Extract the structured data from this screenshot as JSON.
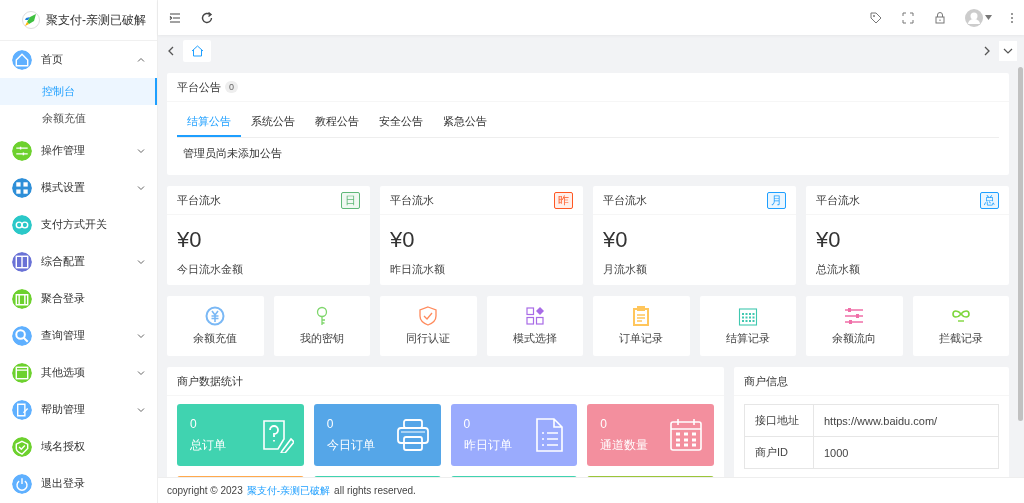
{
  "brand": {
    "name": "聚支付-亲测已破解"
  },
  "sidebar": {
    "items": [
      {
        "label": "首页",
        "color": "#5fb0ff",
        "expanded": true,
        "children": [
          {
            "label": "控制台",
            "selected": true
          },
          {
            "label": "余额充值",
            "selected": false
          }
        ]
      },
      {
        "label": "操作管理",
        "color": "#6dd12e",
        "expanded": false
      },
      {
        "label": "模式设置",
        "color": "#2e8fd8",
        "expanded": false
      },
      {
        "label": "支付方式开关",
        "color": "#2bc8c8"
      },
      {
        "label": "综合配置",
        "color": "#6a72d6",
        "expanded": false
      },
      {
        "label": "聚合登录",
        "color": "#6dd12e"
      },
      {
        "label": "查询管理",
        "color": "#5fb0ff",
        "expanded": false
      },
      {
        "label": "其他选项",
        "color": "#6dd12e",
        "expanded": false
      },
      {
        "label": "帮助管理",
        "color": "#5fb0ff",
        "expanded": false
      },
      {
        "label": "域名授权",
        "color": "#6dd12e"
      },
      {
        "label": "退出登录",
        "color": "#5fb0ff"
      }
    ]
  },
  "notice": {
    "title": "平台公告",
    "count": "0",
    "tabs": [
      {
        "label": "结算公告",
        "selected": true
      },
      {
        "label": "系统公告",
        "selected": false
      },
      {
        "label": "教程公告",
        "selected": false
      },
      {
        "label": "安全公告",
        "selected": false
      },
      {
        "label": "紧急公告",
        "selected": false
      }
    ],
    "message": "管理员尚未添加公告"
  },
  "flow_cards": [
    {
      "title": "平台流水",
      "badge": "日",
      "color": "#5fb878",
      "amount": "¥0",
      "label": "今日流水金额"
    },
    {
      "title": "平台流水",
      "badge": "昨",
      "color": "#ff5722",
      "amount": "¥0",
      "label": "昨日流水额"
    },
    {
      "title": "平台流水",
      "badge": "月",
      "color": "#1e9fff",
      "amount": "¥0",
      "label": "月流水额"
    },
    {
      "title": "平台流水",
      "badge": "总",
      "color": "#1e9fff",
      "amount": "¥0",
      "label": "总流水额"
    }
  ],
  "shortcuts": [
    {
      "label": "余额充值",
      "color": "#7ab8f5"
    },
    {
      "label": "我的密钥",
      "color": "#7ed66b"
    },
    {
      "label": "同行认证",
      "color": "#ff8a5c"
    },
    {
      "label": "模式选择",
      "color": "#a86be6"
    },
    {
      "label": "订单记录",
      "color": "#ffc65c"
    },
    {
      "label": "结算记录",
      "color": "#40c8b0"
    },
    {
      "label": "余额流向",
      "color": "#f06fa8"
    },
    {
      "label": "拦截记录",
      "color": "#7ed63c"
    }
  ],
  "merchant_stats": {
    "title": "商户数据统计",
    "tiles": [
      {
        "value": "0",
        "label": "总订单",
        "color": "#40d3b0"
      },
      {
        "value": "0",
        "label": "今日订单",
        "color": "#55a6e8"
      },
      {
        "value": "0",
        "label": "昨日订单",
        "color": "#9aabfd"
      },
      {
        "value": "0",
        "label": "通道数量",
        "color": "#f38f9e"
      },
      {
        "color": "#ffa94d"
      },
      {
        "color": "#40d3b0"
      },
      {
        "color": "#40d3b0"
      },
      {
        "color": "#9bc53a"
      }
    ]
  },
  "merchant_info": {
    "title": "商户信息",
    "rows": [
      {
        "key": "接口地址",
        "value": "https://www.baidu.com/"
      },
      {
        "key": "商户ID",
        "value": "1000"
      }
    ]
  },
  "footer": {
    "prefix": "copyright © 2023",
    "link": "聚支付-亲测已破解",
    "suffix": "all rights reserved."
  }
}
